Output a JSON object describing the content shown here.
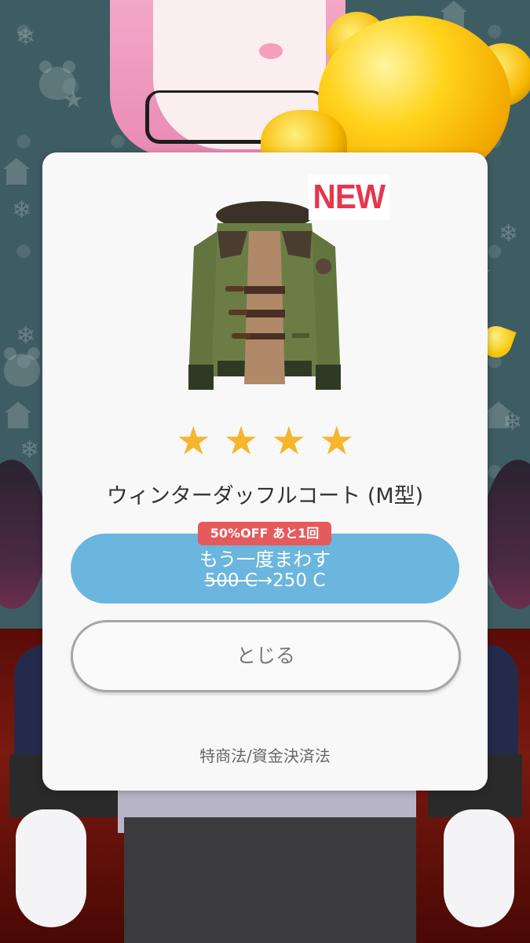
{
  "modal": {
    "new_badge": "NEW",
    "item_name": "ウィンターダッフルコート (M型)",
    "rating_stars": 4,
    "star_color": "#f7b52c",
    "discount_badge": "50%OFF あと1回",
    "spin_button": {
      "label": "もう一度まわす",
      "old_price": "500 C",
      "arrow": "→",
      "new_price": "250 C",
      "color": "#6bb6de"
    },
    "close_button": "とじる",
    "legal_link": "特商法/資金決済法"
  }
}
